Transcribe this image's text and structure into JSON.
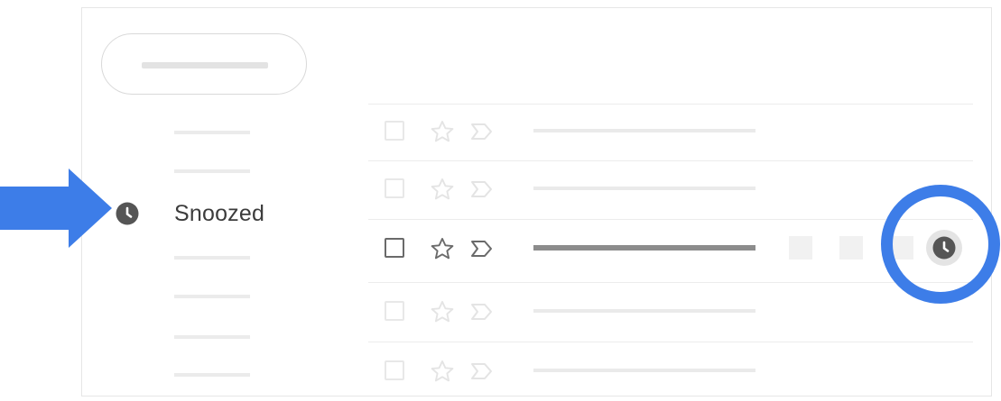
{
  "sidebar": {
    "snoozed_label": "Snoozed",
    "snoozed_icon": "clock-icon"
  },
  "colors": {
    "accent_blue": "#3d7de8",
    "icon_dark": "#555555",
    "text": "#3c3c3c",
    "placeholder": "#ebebeb"
  },
  "mail_list": {
    "active_row_index": 2,
    "active_row_actions": [
      "placeholder-action",
      "placeholder-action",
      "placeholder-action",
      "snooze-icon"
    ]
  }
}
